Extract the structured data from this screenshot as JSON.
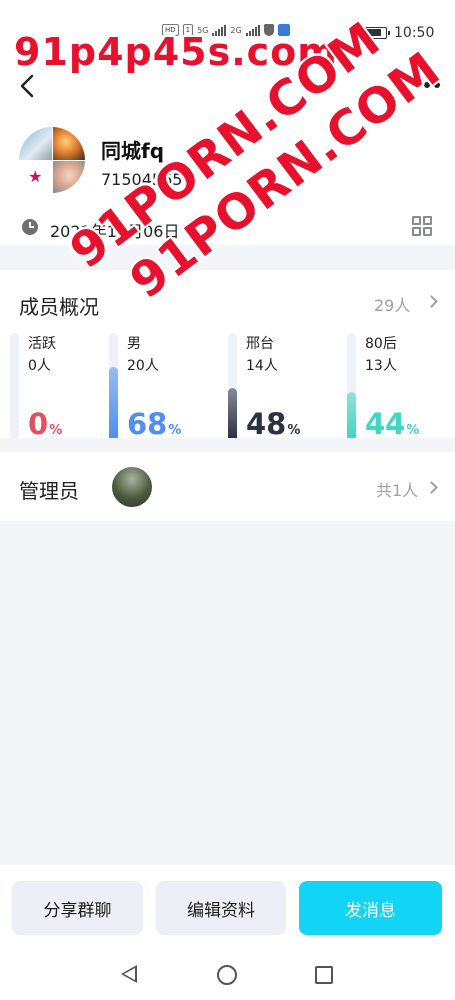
{
  "status_bar": {
    "time": "10:50",
    "indicators": [
      "HD",
      "1",
      "5G",
      "2G"
    ]
  },
  "watermark": {
    "top": "91p4p45s.com",
    "diag_1": "91PORN.COM",
    "diag_2": "91PORN.COM"
  },
  "group": {
    "name": "同城fq",
    "id": "715045659",
    "created": "2021年10月06日"
  },
  "overview": {
    "title": "成员概况",
    "count": "29人",
    "stats": [
      {
        "label": "活跃",
        "sub": "0人",
        "pct": "0",
        "fill": 0.0,
        "color": "#e0505e"
      },
      {
        "label": "男",
        "sub": "20人",
        "pct": "68",
        "fill": 0.68,
        "color": "#4e8ff0"
      },
      {
        "label": "邢台",
        "sub": "14人",
        "pct": "48",
        "fill": 0.48,
        "color": "#2c3244"
      },
      {
        "label": "80后",
        "sub": "13人",
        "pct": "44",
        "fill": 0.44,
        "color": "#3fd6c4"
      }
    ],
    "pct_symbol": "%"
  },
  "admins": {
    "title": "管理员",
    "count": "共1人"
  },
  "actions": {
    "share": "分享群聊",
    "edit": "编辑资料",
    "send": "发消息"
  },
  "colors": {
    "accent": "#12d4f5",
    "background": "#f4f5f9",
    "watermark": "#e8112d"
  },
  "icons": [
    "back-arrow-icon",
    "more-icon",
    "clock-icon",
    "qr-code-icon",
    "chevron-right-icon",
    "nav-back-icon",
    "nav-home-icon",
    "nav-recents-icon"
  ]
}
